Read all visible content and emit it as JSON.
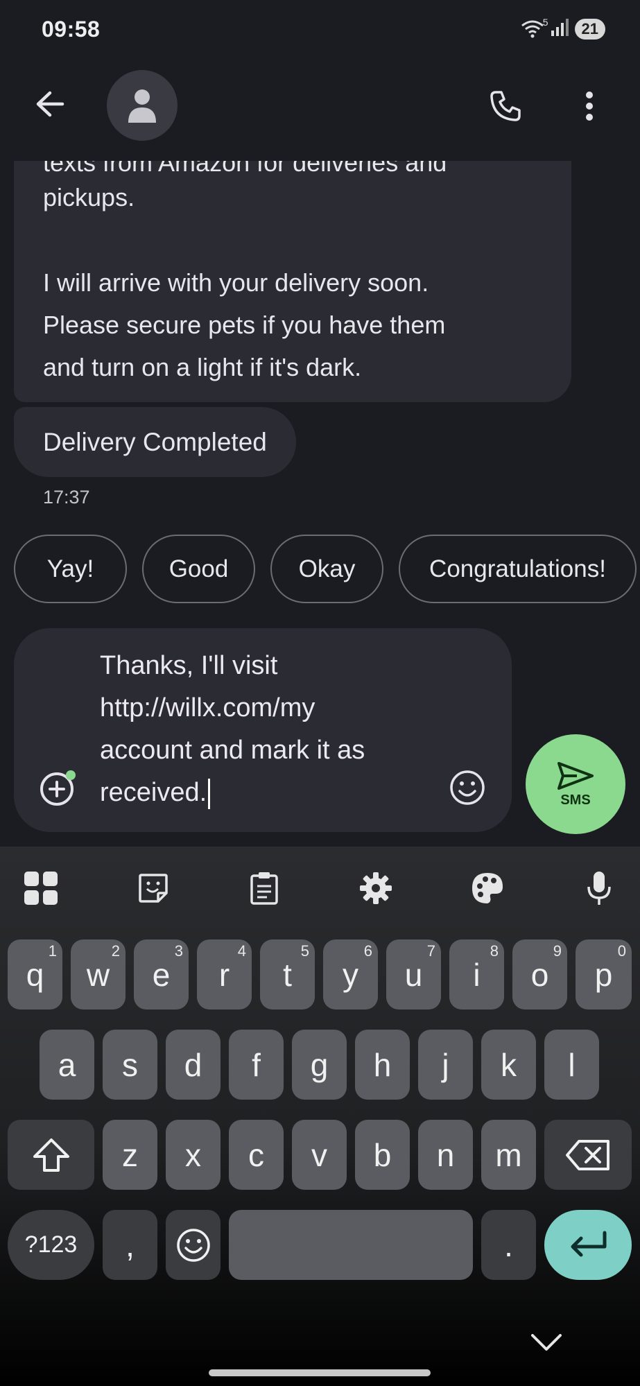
{
  "status": {
    "time": "09:58",
    "wifi_badge": "5",
    "battery": "21"
  },
  "appbar": {
    "back_icon": "arrow-left-icon",
    "avatar_icon": "person-icon",
    "call_icon": "phone-icon",
    "more_icon": "more-vert-icon"
  },
  "conversation": {
    "message1_partial": "texts from Amazon for deliveries and",
    "message1_line2": "pickups.",
    "message1_line3": "I will arrive with your delivery soon.",
    "message1_line4": "Please secure pets if you have them",
    "message1_line5": "and turn on a light if it's dark.",
    "message2": "Delivery Completed",
    "timestamp": "17:37"
  },
  "smart_replies": [
    "Yay!",
    "Good",
    "Okay",
    "Congratulations!"
  ],
  "compose": {
    "text": "Thanks, I'll visit\nhttp://willx.com/my\naccount and mark it as\nreceived.",
    "send_label": "SMS"
  },
  "keyboard": {
    "toolbar": [
      "apps-grid-icon",
      "sticker-icon",
      "clipboard-icon",
      "settings-gear-icon",
      "palette-icon",
      "microphone-icon"
    ],
    "row1": [
      {
        "k": "q",
        "h": "1"
      },
      {
        "k": "w",
        "h": "2"
      },
      {
        "k": "e",
        "h": "3"
      },
      {
        "k": "r",
        "h": "4"
      },
      {
        "k": "t",
        "h": "5"
      },
      {
        "k": "y",
        "h": "6"
      },
      {
        "k": "u",
        "h": "7"
      },
      {
        "k": "i",
        "h": "8"
      },
      {
        "k": "o",
        "h": "9"
      },
      {
        "k": "p",
        "h": "0"
      }
    ],
    "row2": [
      "a",
      "s",
      "d",
      "f",
      "g",
      "h",
      "j",
      "k",
      "l"
    ],
    "row3": [
      "z",
      "x",
      "c",
      "v",
      "b",
      "n",
      "m"
    ],
    "symbols_label": "?123",
    "comma": ",",
    "period": "."
  },
  "colors": {
    "background": "#1b1c22",
    "bubble": "#2b2c33",
    "send": "#8bd88f",
    "enter_key": "#7ed0c6"
  }
}
